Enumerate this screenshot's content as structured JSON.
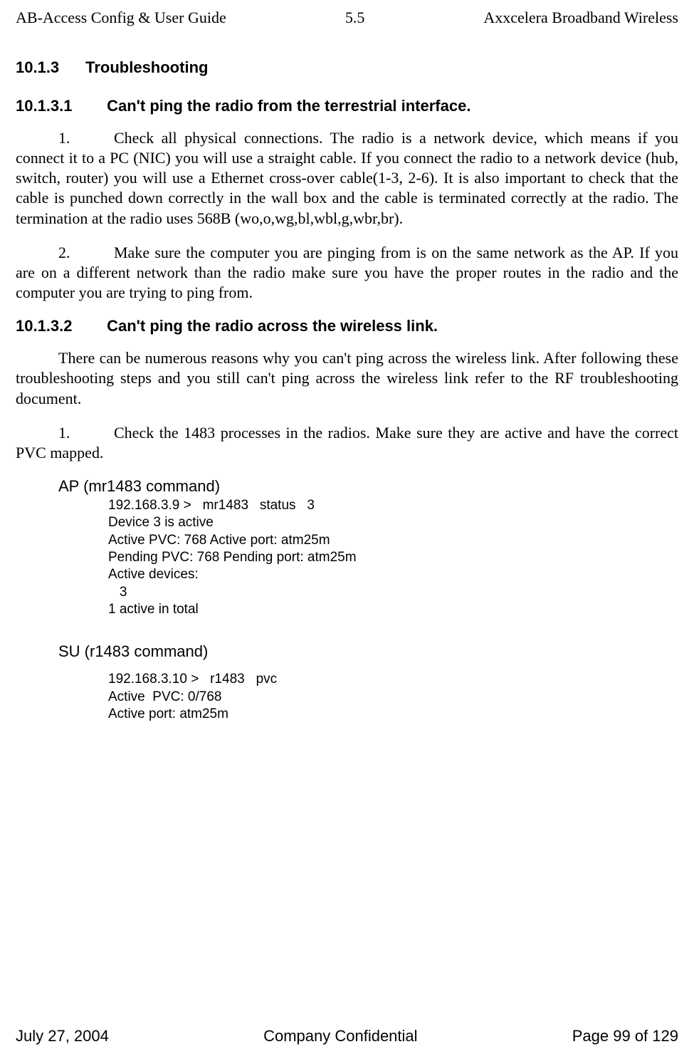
{
  "header": {
    "left": "AB-Access Config & User Guide",
    "center": "5.5",
    "right": "Axxcelera Broadband Wireless"
  },
  "section": {
    "number": "10.1.3",
    "title": "Troubleshooting"
  },
  "sub1": {
    "number": "10.1.3.1",
    "title": "Can't ping the radio from the terrestrial interface."
  },
  "para1_num": "1.",
  "para1": "Check all physical connections. The radio is a network device, which means if you connect it to a PC (NIC) you will use a straight cable. If you connect the radio to a network device (hub, switch, router) you will use a Ethernet cross-over cable(1-3, 2-6). It is also important to check that the cable is punched down correctly in the wall box and the cable is terminated correctly at the radio. The termination at the radio uses 568B (wo,o,wg,bl,wbl,g,wbr,br).",
  "para2_num": "2.",
  "para2": "Make sure the computer you are pinging from is on the same network as the AP. If you are on a different network than the radio make sure you have the proper routes in the radio and the computer you are trying to ping from.",
  "sub2": {
    "number": "10.1.3.2",
    "title": "Can't ping the radio across the wireless link."
  },
  "para3": "There can be numerous reasons why you can't ping across the wireless link. After following these troubleshooting steps and you still can't ping across the wireless link refer to the RF troubleshooting document.",
  "para4_num": "1.",
  "para4": "Check the 1483 processes in the radios. Make sure they are active and have the correct PVC mapped.",
  "ap_intro": "AP (mr1483 command)",
  "ap_code": "192.168.3.9 >   mr1483   status   3\nDevice 3 is active\nActive PVC: 768 Active port: atm25m\nPending PVC: 768 Pending port: atm25m\nActive devices:\n   3\n1 active in total",
  "su_intro": "SU (r1483 command)",
  "su_code": "192.168.3.10 >   r1483   pvc\nActive  PVC: 0/768\nActive port: atm25m",
  "footer": {
    "left": "July 27, 2004",
    "center": "Company Confidential",
    "right": "Page 99 of 129"
  }
}
